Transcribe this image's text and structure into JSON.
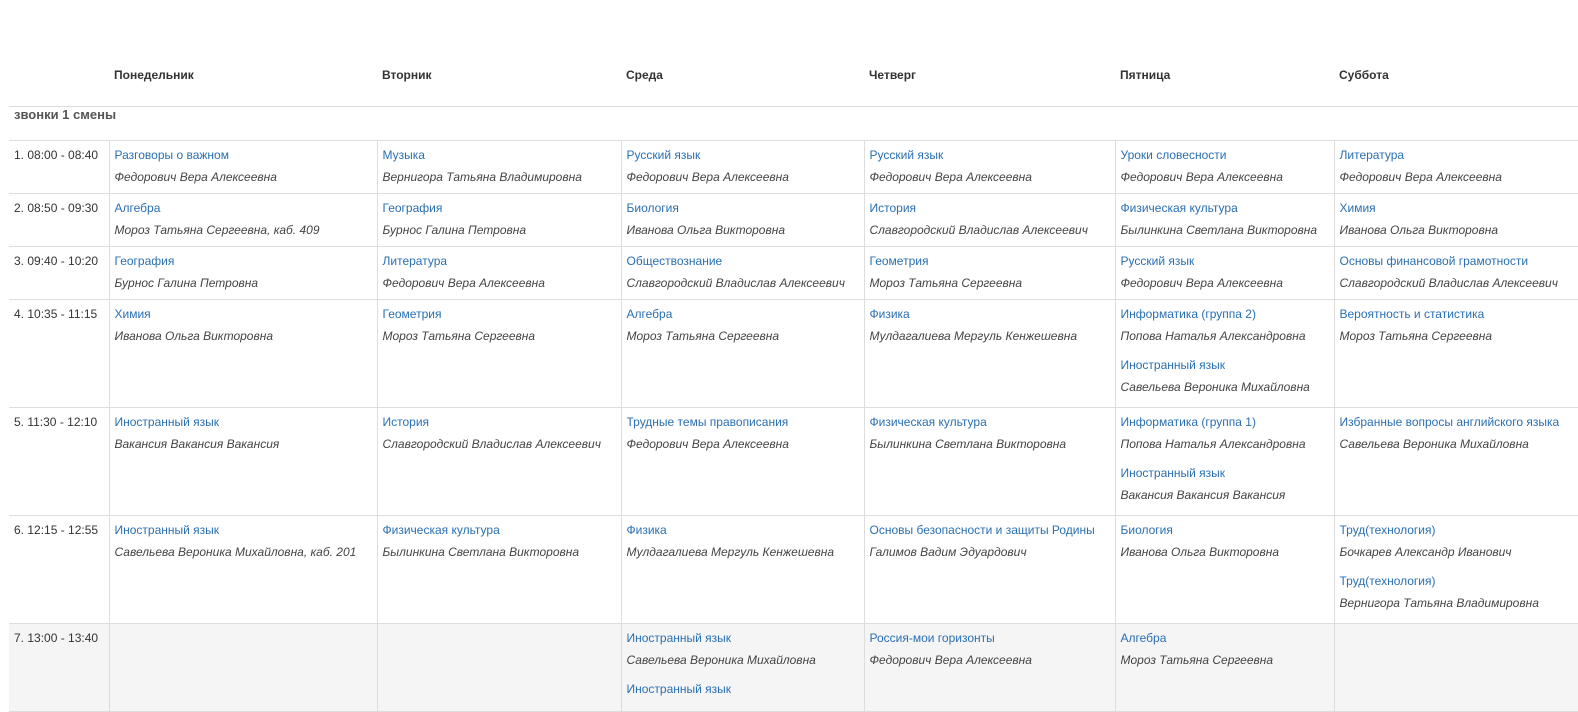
{
  "days": [
    "Понедельник",
    "Вторник",
    "Среда",
    "Четверг",
    "Пятница",
    "Суббота"
  ],
  "shift_label": "звонки 1 смены",
  "rows": [
    {
      "time": "1. 08:00 - 08:40",
      "cells": [
        [
          {
            "subject": "Разговоры о важном",
            "teacher": "Федорович Вера Алексеевна"
          }
        ],
        [
          {
            "subject": "Музыка",
            "teacher": "Вернигора Татьяна Владимировна"
          }
        ],
        [
          {
            "subject": "Русский язык",
            "teacher": "Федорович Вера Алексеевна"
          }
        ],
        [
          {
            "subject": "Русский язык",
            "teacher": "Федорович Вера Алексеевна"
          }
        ],
        [
          {
            "subject": "Уроки словесности",
            "teacher": "Федорович Вера Алексеевна"
          }
        ],
        [
          {
            "subject": "Литература",
            "teacher": "Федорович Вера Алексеевна"
          }
        ]
      ]
    },
    {
      "time": "2. 08:50 - 09:30",
      "cells": [
        [
          {
            "subject": "Алгебра",
            "teacher": "Мороз Татьяна Сергеевна, каб. 409"
          }
        ],
        [
          {
            "subject": "География",
            "teacher": "Бурнос Галина Петровна"
          }
        ],
        [
          {
            "subject": "Биология",
            "teacher": "Иванова Ольга Викторовна"
          }
        ],
        [
          {
            "subject": "История",
            "teacher": "Славгородский Владислав Алексеевич"
          }
        ],
        [
          {
            "subject": "Физическая культура",
            "teacher": "Былинкина Светлана Викторовна"
          }
        ],
        [
          {
            "subject": "Химия",
            "teacher": "Иванова Ольга Викторовна"
          }
        ]
      ]
    },
    {
      "time": "3. 09:40 - 10:20",
      "cells": [
        [
          {
            "subject": "География",
            "teacher": "Бурнос Галина Петровна"
          }
        ],
        [
          {
            "subject": "Литература",
            "teacher": "Федорович Вера Алексеевна"
          }
        ],
        [
          {
            "subject": "Обществознание",
            "teacher": "Славгородский Владислав Алексеевич"
          }
        ],
        [
          {
            "subject": "Геометрия",
            "teacher": "Мороз Татьяна Сергеевна"
          }
        ],
        [
          {
            "subject": "Русский язык",
            "teacher": "Федорович Вера Алексеевна"
          }
        ],
        [
          {
            "subject": "Основы финансовой грамотности",
            "teacher": "Славгородский Владислав Алексеевич"
          }
        ]
      ]
    },
    {
      "time": "4. 10:35 - 11:15",
      "cells": [
        [
          {
            "subject": "Химия",
            "teacher": "Иванова Ольга Викторовна"
          }
        ],
        [
          {
            "subject": "Геометрия",
            "teacher": "Мороз Татьяна Сергеевна"
          }
        ],
        [
          {
            "subject": "Алгебра",
            "teacher": "Мороз Татьяна Сергеевна"
          }
        ],
        [
          {
            "subject": "Физика",
            "teacher": "Мулдагалиева Мергуль Кенжешевна"
          }
        ],
        [
          {
            "subject": "Информатика (группа 2)",
            "teacher": "Попова Наталья Александровна"
          },
          {
            "subject": "Иностранный язык",
            "teacher": "Савельева Вероника Михайловна"
          }
        ],
        [
          {
            "subject": "Вероятность и статистика",
            "teacher": "Мороз Татьяна Сергеевна"
          }
        ]
      ]
    },
    {
      "time": "5. 11:30 - 12:10",
      "cells": [
        [
          {
            "subject": "Иностранный язык",
            "teacher": "Вакансия Вакансия Вакансия"
          }
        ],
        [
          {
            "subject": "История",
            "teacher": "Славгородский Владислав Алексеевич"
          }
        ],
        [
          {
            "subject": "Трудные темы правописания",
            "teacher": "Федорович Вера Алексеевна"
          }
        ],
        [
          {
            "subject": "Физическая культура",
            "teacher": "Былинкина Светлана Викторовна"
          }
        ],
        [
          {
            "subject": "Информатика (группа 1)",
            "teacher": "Попова Наталья Александровна"
          },
          {
            "subject": "Иностранный язык",
            "teacher": "Вакансия Вакансия Вакансия"
          }
        ],
        [
          {
            "subject": "Избранные вопросы английского языка",
            "teacher": "Савельева Вероника Михайловна"
          }
        ]
      ]
    },
    {
      "time": "6. 12:15 - 12:55",
      "cells": [
        [
          {
            "subject": "Иностранный язык",
            "teacher": "Савельева Вероника Михайловна, каб. 201"
          }
        ],
        [
          {
            "subject": "Физическая культура",
            "teacher": "Былинкина Светлана Викторовна"
          }
        ],
        [
          {
            "subject": "Физика",
            "teacher": "Мулдагалиева Мергуль Кенжешевна"
          }
        ],
        [
          {
            "subject": "Основы безопасности и защиты Родины",
            "teacher": "Галимов Вадим Эдуардович"
          }
        ],
        [
          {
            "subject": "Биология",
            "teacher": "Иванова Ольга Викторовна"
          }
        ],
        [
          {
            "subject": "Труд(технология)",
            "teacher": "Бочкарев Александр Иванович"
          },
          {
            "subject": "Труд(технология)",
            "teacher": "Вернигора Татьяна Владимировна"
          }
        ]
      ]
    },
    {
      "time": "7. 13:00 - 13:40",
      "cells": [
        [],
        [],
        [
          {
            "subject": "Иностранный язык",
            "teacher": "Савельева Вероника Михайловна"
          },
          {
            "subject": "Иностранный язык",
            "teacher": ""
          }
        ],
        [
          {
            "subject": "Россия-мои горизонты",
            "teacher": "Федорович Вера Алексеевна"
          }
        ],
        [
          {
            "subject": "Алгебра",
            "teacher": "Мороз Татьяна Сергеевна"
          }
        ],
        []
      ]
    }
  ]
}
